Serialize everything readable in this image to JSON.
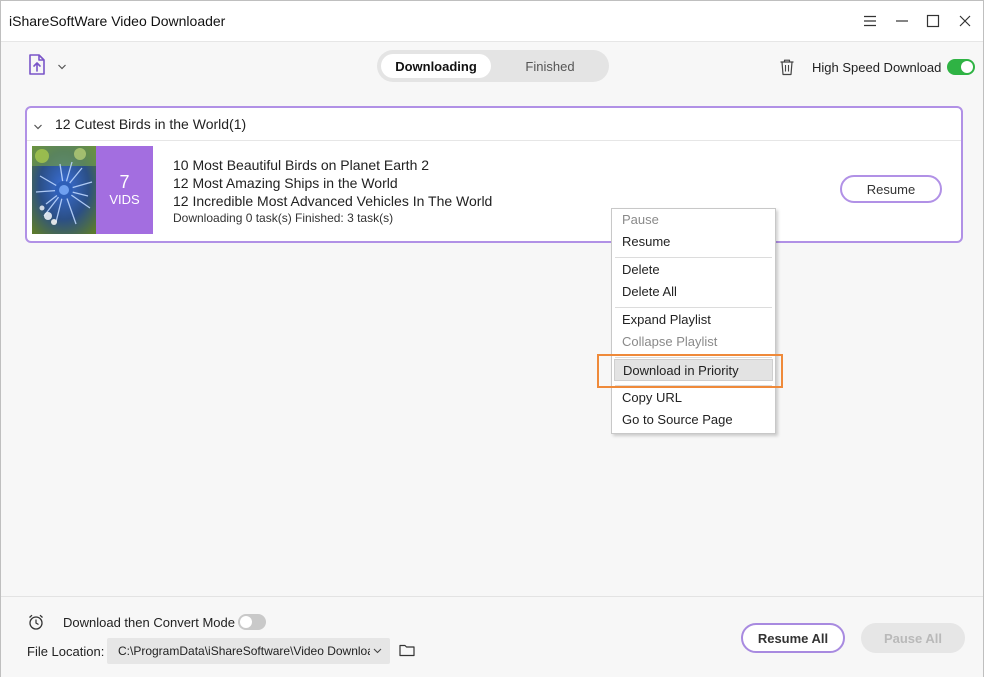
{
  "window": {
    "title": "iShareSoftWare Video Downloader"
  },
  "icons": {
    "add": "add-url-icon",
    "dropdown": "chevron-down-icon",
    "trash": "trash-icon",
    "minimize": "hamburger-menu-icon",
    "alarm": "alarm-clock-icon",
    "folder": "folder-icon"
  },
  "toolbar": {
    "tabs": [
      {
        "label": "Downloading",
        "active": true
      },
      {
        "label": "Finished",
        "active": false
      }
    ],
    "high_speed_label": "High Speed Download",
    "high_speed_enabled": true
  },
  "playlist": {
    "title": "12 Cutest Birds in the World(1)",
    "vids_count": "7",
    "vids_label": "VIDS",
    "items": [
      "10 Most Beautiful Birds on Planet Earth 2",
      "12 Most Amazing Ships in the World",
      "12 Incredible Most Advanced Vehicles In The World"
    ],
    "status": "Downloading 0 task(s) Finished: 3 task(s)",
    "resume_label": "Resume"
  },
  "context_menu": {
    "items": [
      {
        "label": "Pause",
        "disabled": true
      },
      {
        "label": "Resume",
        "disabled": false
      },
      {
        "label": "Delete",
        "disabled": false
      },
      {
        "label": "Delete All",
        "disabled": false
      },
      {
        "label": "Expand Playlist",
        "disabled": false
      },
      {
        "label": "Collapse Playlist",
        "disabled": true
      },
      {
        "label": "Download in Priority",
        "disabled": false,
        "highlighted": true
      },
      {
        "label": "Copy URL",
        "disabled": false
      },
      {
        "label": "Go to Source Page",
        "disabled": false
      }
    ]
  },
  "footer": {
    "convert_mode_label": "Download then Convert Mode",
    "convert_mode_enabled": false,
    "file_location_label": "File Location:",
    "file_location_value": "C:\\ProgramData\\iShareSoftware\\Video Downloader",
    "resume_all_label": "Resume All",
    "pause_all_label": "Pause All"
  },
  "colors": {
    "accent_purple": "#a36ee0",
    "toggle_on": "#2fb344",
    "highlight_orange": "#ef8a3a"
  }
}
